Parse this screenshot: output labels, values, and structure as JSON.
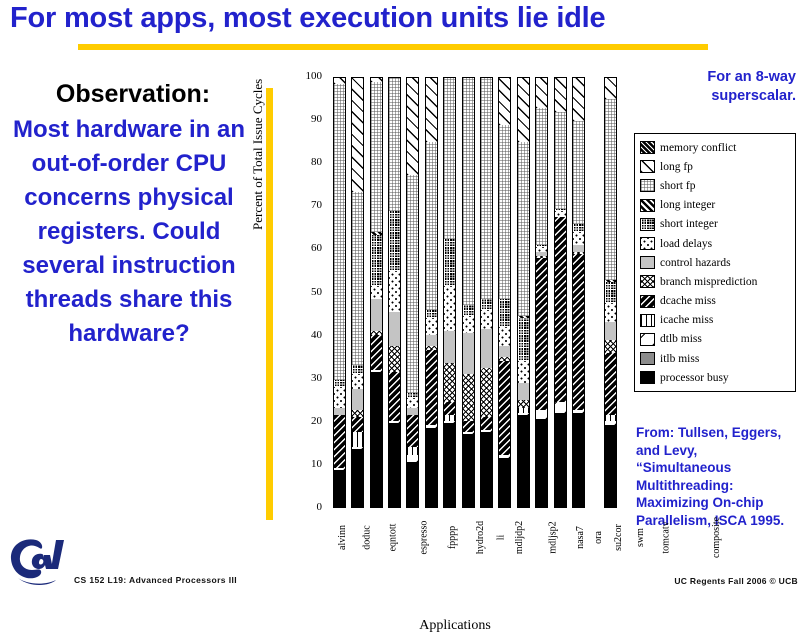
{
  "slide": {
    "title": "For most apps, most execution units lie idle",
    "accent_yellow": "#ffcc00",
    "accent_blue": "#2222cc"
  },
  "left": {
    "observation_heading": "Observation:",
    "observation_body": "Most hardware in an out-of-order CPU concerns physical registers. Could several instruction threads share this hardware?",
    "footer": "CS 152 L19: Advanced Processors III",
    "logo_label": "Cal"
  },
  "right": {
    "heading": "For an 8-way superscalar.",
    "citation": "From: Tullsen, Eggers, and Levy, “Simultaneous Multithreading: Maximizing On-chip Parallelism, ISCA 1995.",
    "footer": "UC Regents Fall 2006 © UCB"
  },
  "chart_data": {
    "type": "bar",
    "stacked": true,
    "title": "",
    "xlabel": "Applications",
    "ylabel": "Percent of Total Issue Cycles",
    "ylim": [
      0,
      100
    ],
    "yticks": [
      100,
      90,
      80,
      70,
      60,
      50,
      40,
      30,
      20,
      10,
      0
    ],
    "grid": false,
    "legend_position": "right-outside",
    "categories": [
      "alvinn",
      "doduc",
      "eqntott",
      "espresso",
      "fpppp",
      "hydro2d",
      "li",
      "mdljdp2",
      "mdljsp2",
      "nasa7",
      "ora",
      "su2cor",
      "swm",
      "tomcatv",
      "composite"
    ],
    "series": [
      {
        "name": "processor busy",
        "pattern": "p-processor-busy",
        "values": [
          8.5,
          13.5,
          31.5,
          19.5,
          10.5,
          18.5,
          19.5,
          17.0,
          17.5,
          11.5,
          21.5,
          20.5,
          22.0,
          22.0,
          19.0
        ]
      },
      {
        "name": "itlb miss",
        "pattern": "p-itlb-miss",
        "values": [
          0.0,
          0.0,
          0.0,
          0.0,
          0.0,
          0.0,
          0.0,
          0.0,
          0.0,
          0.0,
          0.0,
          0.0,
          0.0,
          0.0,
          0.0
        ]
      },
      {
        "name": "dtlb miss",
        "pattern": "p-dtlb-miss",
        "values": [
          0.5,
          0.5,
          0.5,
          0.5,
          1.5,
          0.5,
          0.5,
          0.5,
          0.5,
          0.5,
          0.5,
          2.0,
          2.5,
          0.5,
          1.0
        ]
      },
      {
        "name": "icache miss",
        "pattern": "p-icache-miss",
        "values": [
          0.0,
          3.5,
          0.0,
          0.0,
          2.0,
          0.0,
          1.5,
          0.0,
          0.0,
          0.0,
          1.0,
          0.0,
          0.0,
          0.0,
          1.5
        ]
      },
      {
        "name": "dcache miss",
        "pattern": "p-dcache-miss",
        "values": [
          12.5,
          3.5,
          8.0,
          11.5,
          7.5,
          17.5,
          3.0,
          2.5,
          3.0,
          22.0,
          0.0,
          35.5,
          43.0,
          36.5,
          14.5
        ]
      },
      {
        "name": "branch misprediction",
        "pattern": "p-branch-misprediction",
        "values": [
          0.0,
          1.5,
          1.0,
          6.0,
          0.0,
          1.0,
          9.0,
          11.0,
          11.5,
          1.0,
          2.0,
          0.5,
          0.0,
          0.5,
          3.0
        ]
      },
      {
        "name": "control hazards",
        "pattern": "p-control-hazards",
        "values": [
          1.5,
          5.0,
          7.5,
          8.0,
          1.5,
          2.5,
          7.5,
          9.5,
          9.0,
          2.5,
          4.0,
          1.0,
          0.0,
          1.5,
          4.0
        ]
      },
      {
        "name": "load delays",
        "pattern": "p-load-delays",
        "values": [
          5.0,
          3.5,
          3.0,
          9.5,
          2.5,
          4.0,
          10.5,
          4.0,
          4.5,
          4.5,
          5.0,
          1.0,
          1.5,
          3.0,
          4.5
        ]
      },
      {
        "name": "short integer",
        "pattern": "p-short-integer",
        "values": [
          1.5,
          2.0,
          12.0,
          14.0,
          1.0,
          2.0,
          11.0,
          2.5,
          2.5,
          6.5,
          10.0,
          0.5,
          0.5,
          2.0,
          5.0
        ]
      },
      {
        "name": "long integer",
        "pattern": "p-long-integer",
        "values": [
          0.0,
          0.0,
          0.5,
          0.0,
          0.0,
          0.0,
          0.0,
          0.0,
          0.0,
          0.0,
          0.5,
          0.0,
          0.0,
          0.0,
          0.5
        ]
      },
      {
        "name": "short fp",
        "pattern": "p-short-fp",
        "values": [
          69.0,
          40.5,
          35.0,
          31.0,
          51.0,
          39.0,
          37.5,
          53.0,
          51.5,
          40.5,
          40.5,
          32.0,
          22.5,
          24.0,
          42.0
        ]
      },
      {
        "name": "long fp",
        "pattern": "p-long-fp",
        "values": [
          1.5,
          26.5,
          1.0,
          0.0,
          22.5,
          15.0,
          0.0,
          0.0,
          0.0,
          11.0,
          15.0,
          7.0,
          8.0,
          10.0,
          5.0
        ]
      },
      {
        "name": "memory conflict",
        "pattern": "p-memory-conflict",
        "values": [
          0.0,
          0.0,
          0.0,
          0.0,
          0.0,
          0.0,
          0.0,
          0.0,
          0.0,
          0.0,
          0.0,
          0.0,
          0.0,
          0.0,
          0.0
        ]
      }
    ]
  },
  "legend": {
    "items": [
      {
        "label": "memory conflict",
        "pattern": "p-memory-conflict"
      },
      {
        "label": "long fp",
        "pattern": "p-long-fp"
      },
      {
        "label": "short fp",
        "pattern": "p-short-fp"
      },
      {
        "label": "long integer",
        "pattern": "p-long-integer"
      },
      {
        "label": "short integer",
        "pattern": "p-short-integer"
      },
      {
        "label": "load delays",
        "pattern": "p-load-delays"
      },
      {
        "label": "control hazards",
        "pattern": "p-control-hazards"
      },
      {
        "label": "branch misprediction",
        "pattern": "p-branch-misprediction"
      },
      {
        "label": "dcache miss",
        "pattern": "p-dcache-miss"
      },
      {
        "label": "icache miss",
        "pattern": "p-icache-miss"
      },
      {
        "label": "dtlb miss",
        "pattern": "p-dtlb-miss"
      },
      {
        "label": "itlb miss",
        "pattern": "p-itlb-miss"
      },
      {
        "label": "processor busy",
        "pattern": "p-processor-busy"
      }
    ]
  }
}
